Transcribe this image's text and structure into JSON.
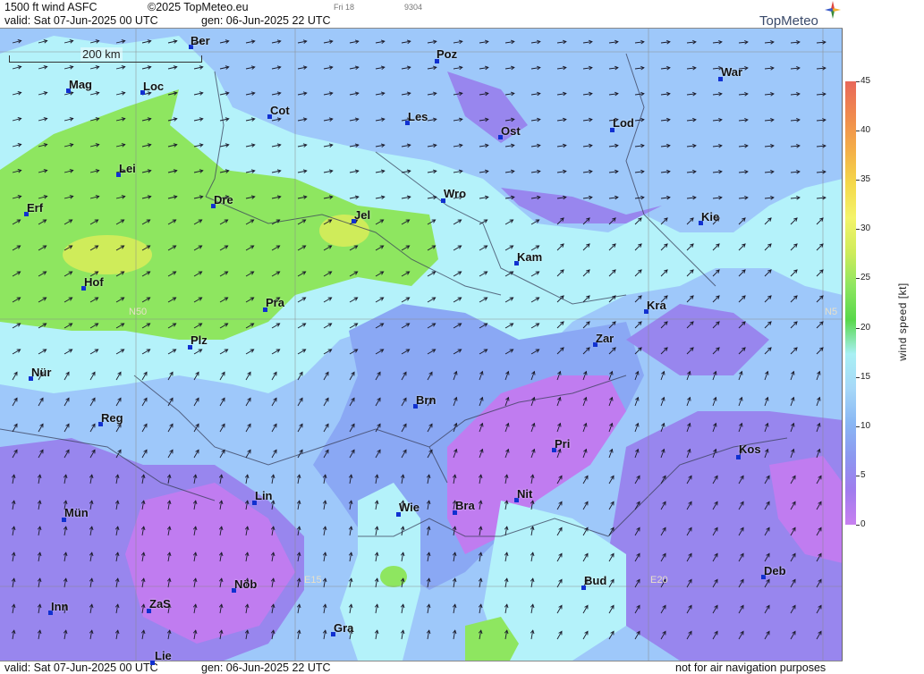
{
  "header": {
    "product": "1500 ft wind ASFC",
    "copyright": "©2025 TopMeteo.eu",
    "day_tag": "Fri 18",
    "code": "9304",
    "valid": "valid:  Sat  07-Jun-2025  00 UTC",
    "gen": "gen: 06-Jun-2025 22 UTC",
    "brand": "TopMeteo"
  },
  "footer": {
    "valid": "valid:  Sat  07-Jun-2025  00 UTC",
    "gen": "gen: 06-Jun-2025 22 UTC",
    "disclaimer": "not for air navigation purposes"
  },
  "scale": {
    "label": "200 km"
  },
  "grid_labels": {
    "n50_left": "N50",
    "n50_right": "N5",
    "e15": "E15",
    "e20": "E20"
  },
  "cities": [
    {
      "name": "Ber"
    },
    {
      "name": "Poz"
    },
    {
      "name": "War"
    },
    {
      "name": "Mag"
    },
    {
      "name": "Loc"
    },
    {
      "name": "Cot"
    },
    {
      "name": "Les"
    },
    {
      "name": "Lod"
    },
    {
      "name": "Ost"
    },
    {
      "name": "Lei"
    },
    {
      "name": "Dre"
    },
    {
      "name": "Wro"
    },
    {
      "name": "Erf"
    },
    {
      "name": "Jel"
    },
    {
      "name": "Kie"
    },
    {
      "name": "Kam"
    },
    {
      "name": "Hof"
    },
    {
      "name": "Pra"
    },
    {
      "name": "Kra"
    },
    {
      "name": "Zar"
    },
    {
      "name": "Plz"
    },
    {
      "name": "Nür"
    },
    {
      "name": "Brn"
    },
    {
      "name": "Reg"
    },
    {
      "name": "Pri"
    },
    {
      "name": "Kos"
    },
    {
      "name": "Lin"
    },
    {
      "name": "Nit"
    },
    {
      "name": "Wie"
    },
    {
      "name": "Bra"
    },
    {
      "name": "Mün"
    },
    {
      "name": "Nöb"
    },
    {
      "name": "Bud"
    },
    {
      "name": "Deb"
    },
    {
      "name": "Inn"
    },
    {
      "name": "ZaS"
    },
    {
      "name": "Gra"
    },
    {
      "name": "Lie"
    }
  ],
  "legend": {
    "title": "wind  speed  [kt]",
    "ticks": [
      "45",
      "40",
      "35",
      "30",
      "25",
      "20",
      "15",
      "10",
      "5",
      "0"
    ],
    "colors": [
      "#e8685a",
      "#f08a4e",
      "#f4ae48",
      "#f4d84a",
      "#f4f46a",
      "#cfec5a",
      "#8ee660",
      "#58d84a",
      "#a8f0f4",
      "#a6d8f8",
      "#8ab8f4",
      "#8c98f0",
      "#a07cee",
      "#c880f0"
    ]
  },
  "wind_field": {
    "colors": {
      "light_cyan": "#b4f2fa",
      "light_blue": "#9ec8fa",
      "mid_blue": "#8aa8f4",
      "violet": "#9886ee",
      "purple": "#c07cf0",
      "green": "#8ee660",
      "lime": "#cfec5a"
    }
  }
}
